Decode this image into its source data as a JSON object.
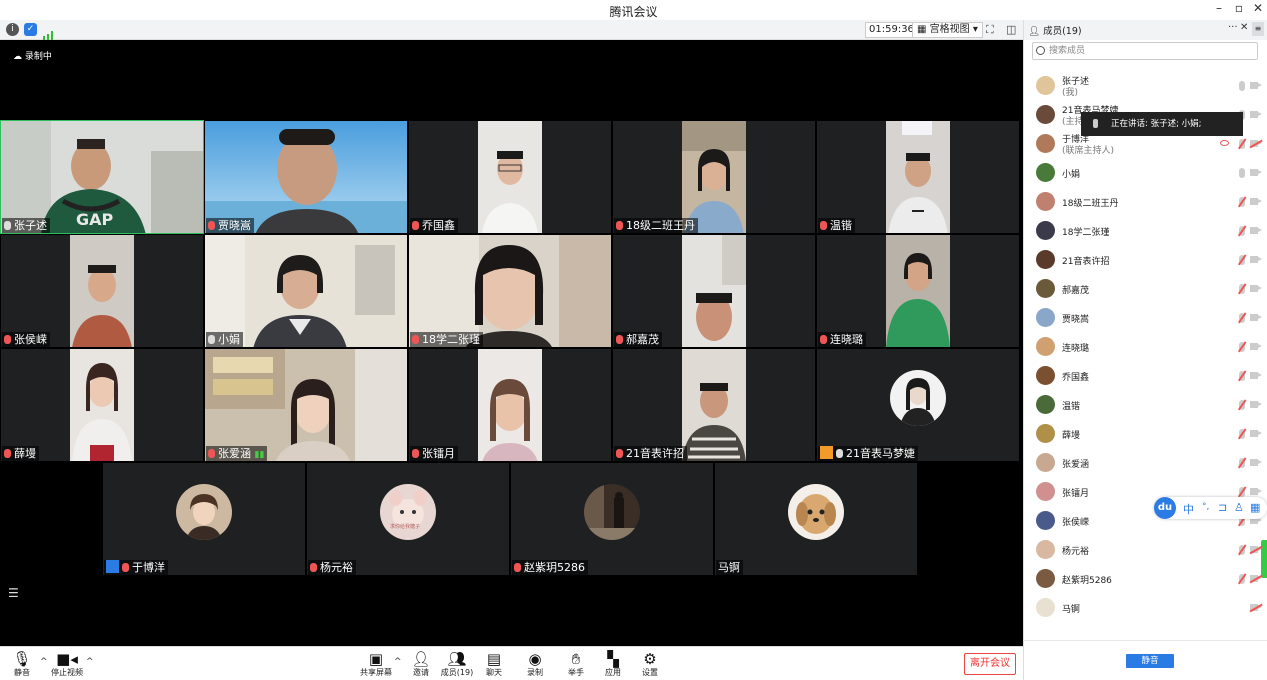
{
  "window": {
    "title": "腾讯会议",
    "minimize": "–",
    "restore": "▫",
    "close": "✕"
  },
  "subbar": {
    "timer": "01:59:36",
    "view_label": "宫格视图",
    "view_arrow": "▾"
  },
  "stage": {
    "recording_label": "录制中"
  },
  "tiles": [
    {
      "name": "张子述",
      "mic_off": false
    },
    {
      "name": "贾晓嵩",
      "mic_off": true
    },
    {
      "name": "乔国鑫",
      "mic_off": true
    },
    {
      "name": "18级二班王丹",
      "mic_off": true
    },
    {
      "name": "温锴",
      "mic_off": true
    },
    {
      "name": "张侯嵘",
      "mic_off": true
    },
    {
      "name": "小娟",
      "mic_off": false
    },
    {
      "name": "18学二张瑾",
      "mic_off": true
    },
    {
      "name": "郝嘉茂",
      "mic_off": true
    },
    {
      "name": "连晓璐",
      "mic_off": true
    },
    {
      "name": "薛墁",
      "mic_off": true
    },
    {
      "name": "张爱涵",
      "mic_off": true
    },
    {
      "name": "张镭月",
      "mic_off": true
    },
    {
      "name": "21音表许招",
      "mic_off": true
    },
    {
      "name": "21音表马梦婕",
      "mic_off": false
    },
    {
      "name": "于博洋",
      "mic_off": true
    },
    {
      "name": "杨元裕",
      "mic_off": true
    },
    {
      "name": "赵紫玥5286",
      "mic_off": true
    },
    {
      "name": "马锕",
      "mic_off": false
    }
  ],
  "avatar_text": {
    "yang": "求你给我糖子"
  },
  "toolbar": {
    "mute": "静音",
    "stop_video": "停止视频",
    "share": "共享屏幕",
    "invite": "邀请",
    "members": "成员(19)",
    "chat": "聊天",
    "record": "录制",
    "raise_hand": "举手",
    "apps": "应用",
    "settings": "设置",
    "leave": "离开会议"
  },
  "panel": {
    "title": "成员(19)",
    "more": "···",
    "close": "✕",
    "search_placeholder": "搜索成员",
    "speaking": "正在讲话: 张子述; 小娟;",
    "mute_all": "静音",
    "members": [
      {
        "name": "张子述",
        "sub": "(我)",
        "mic_off": false,
        "cam_off": false
      },
      {
        "name": "21音表马梦婕",
        "sub": "(主持人)",
        "mic_off": false,
        "cam_off": false
      },
      {
        "name": "于博洋",
        "sub": "(联席主持人)",
        "mic_off": true,
        "cam_off": true
      },
      {
        "name": "小娟",
        "sub": "",
        "mic_off": false,
        "cam_off": false
      },
      {
        "name": "18级二班王丹",
        "sub": "",
        "mic_off": true,
        "cam_off": false
      },
      {
        "name": "18学二张瑾",
        "sub": "",
        "mic_off": true,
        "cam_off": false
      },
      {
        "name": "21音表许招",
        "sub": "",
        "mic_off": true,
        "cam_off": false
      },
      {
        "name": "郝嘉茂",
        "sub": "",
        "mic_off": true,
        "cam_off": false
      },
      {
        "name": "贾晓嵩",
        "sub": "",
        "mic_off": true,
        "cam_off": false
      },
      {
        "name": "连晓璐",
        "sub": "",
        "mic_off": true,
        "cam_off": false
      },
      {
        "name": "乔国鑫",
        "sub": "",
        "mic_off": true,
        "cam_off": false
      },
      {
        "name": "温锴",
        "sub": "",
        "mic_off": true,
        "cam_off": false
      },
      {
        "name": "薛墁",
        "sub": "",
        "mic_off": true,
        "cam_off": false
      },
      {
        "name": "张爱涵",
        "sub": "",
        "mic_off": true,
        "cam_off": false
      },
      {
        "name": "张镭月",
        "sub": "",
        "mic_off": true,
        "cam_off": false
      },
      {
        "name": "张侯嵘",
        "sub": "",
        "mic_off": true,
        "cam_off": false
      },
      {
        "name": "杨元裕",
        "sub": "",
        "mic_off": true,
        "cam_off": true
      },
      {
        "name": "赵紫玥5286",
        "sub": "",
        "mic_off": true,
        "cam_off": true
      },
      {
        "name": "马锕",
        "sub": "",
        "mic_off": false,
        "cam_off": true
      }
    ]
  },
  "ime": {
    "logo": "du",
    "lang": "中",
    "punct": "°,"
  },
  "colors": {
    "accent": "#2a7be4",
    "danger": "#e33333",
    "active_border": "#2fbf5f"
  }
}
